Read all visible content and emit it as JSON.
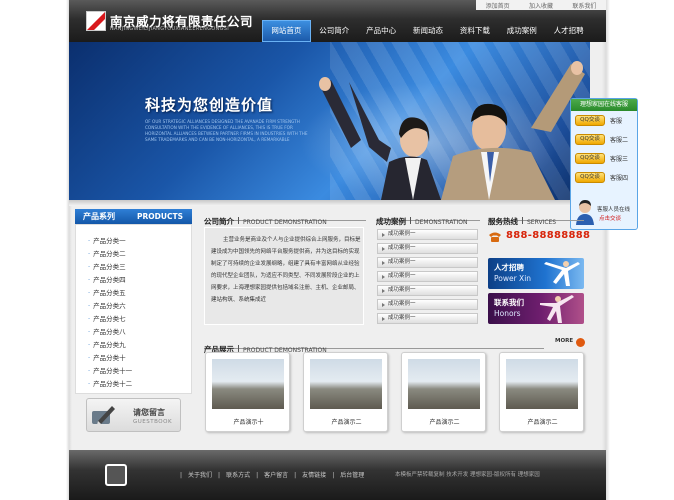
{
  "top_links": [
    "添加首页",
    "加入收藏",
    "联系我们"
  ],
  "logo": {
    "cn": "南京威力将有限责任公司",
    "en": "NANJINGWEILIJIANGYOUXIANZERENGONGSI"
  },
  "nav": {
    "items": [
      "网站首页",
      "公司简介",
      "产品中心",
      "新闻动态",
      "资料下载",
      "成功案例",
      "人才招聘"
    ],
    "active_index": 0
  },
  "banner": {
    "slogan": "科技为您创造价值",
    "english": "OF OUR STRATEGIC ALLIANCES DESIGNED THE AVANADE FIRM STRENGTH CONSULTATION WITH THE EVIDENCE OF ALLIANCES, THIS IS TRUE FOR HORIZONTAL ALLIANCES BETWEEN PARTNER FIRMS IN INDUSTRIES WITH THE SAME TRADEMARKS AND CAN BE NON-HORIZONTAL, A REMARKABLE"
  },
  "qq_float": {
    "title": "理想家园在线客服",
    "buttons": [
      {
        "btn": "QQ交谈",
        "name": "客服"
      },
      {
        "btn": "QQ交谈",
        "name": "客服二"
      },
      {
        "btn": "QQ交谈",
        "name": "客服三"
      },
      {
        "btn": "QQ交谈",
        "name": "客服四"
      }
    ],
    "service_label": "客服人员在线",
    "click_label": "点击交谈"
  },
  "products": {
    "title_cn": "产品系列",
    "title_en": "PRODUCTS",
    "items": [
      "产品分类一",
      "产品分类二",
      "产品分类三",
      "产品分类四",
      "产品分类五",
      "产品分类六",
      "产品分类七",
      "产品分类八",
      "产品分类九",
      "产品分类十",
      "产品分类十一",
      "产品分类十二"
    ]
  },
  "guestbook": {
    "cn": "请您留言",
    "en": "GUESTBOOK"
  },
  "about": {
    "title_cn": "公司简介",
    "title_en": "PRODUCT DEMONSTRATION",
    "text": "主营业务是商业及个人与企业提供综合上网服务，目标是建设成为中国领先的网络平台服务提供商，并为这目标的实现制定了可持续的企业发展纲略，组建了具有丰富网络从业经验的现代型企业团队，为适应不同类型、不同发展阶段企业的上网要求，上海理想家园提供包括域名注册、主机、企业邮局、建站构筑、系统集成近"
  },
  "cases": {
    "title_cn": "成功案例",
    "title_en": "DEMONSTRATION",
    "items": [
      "成功案例一",
      "成功案例一",
      "成功案例一",
      "成功案例一",
      "成功案例一",
      "成功案例一",
      "成功案例一"
    ]
  },
  "service": {
    "title_cn": "服务热线",
    "title_en": "SERVICES",
    "phone": "888-88888888",
    "banner1": {
      "cn": "人才招聘",
      "en": "Power Xin"
    },
    "banner2": {
      "cn": "联系我们",
      "en": "Honors"
    }
  },
  "showcase": {
    "title_cn": "产品展示",
    "title_en": "PRODUCT DEMONSTRATION",
    "more": "MORE",
    "items": [
      "产品演示十",
      "产品演示二",
      "产品演示二",
      "产品演示二"
    ]
  },
  "footer": {
    "links": [
      "关于我们",
      "联系方式",
      "客户留言",
      "友情链接",
      "后台管理"
    ],
    "right": "本模板严禁转载复制  技术开发  理想家园-版权所有 理想家园"
  },
  "colors": {
    "accent": "#1a6bc4",
    "phone": "#d8240a",
    "nav_active": "#3c8fe0"
  }
}
